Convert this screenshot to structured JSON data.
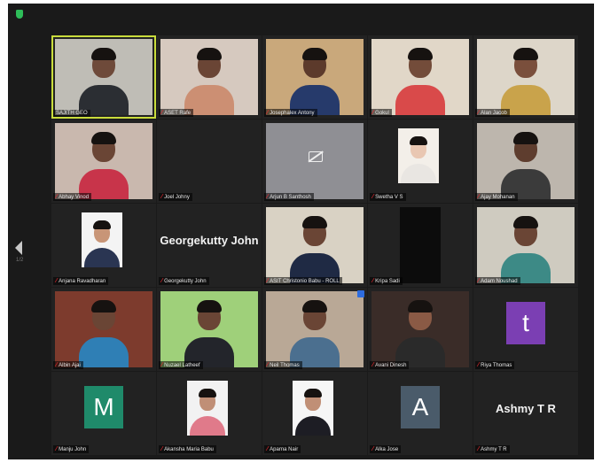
{
  "app": {
    "title": ""
  },
  "nav": {
    "page_indicator": "1/2"
  },
  "participants": [
    {
      "name": "SAJITH GEO",
      "kind": "video",
      "active": true,
      "bg": "#bfbdb6",
      "skin": "#6e4a3a",
      "shirt": "#2b2e33",
      "muted": false
    },
    {
      "name": "ASET Rafe",
      "kind": "video",
      "bg": "#d6c9bf",
      "skin": "#6a4535",
      "shirt": "#cc8f73",
      "muted": true
    },
    {
      "name": "Josephalex Antony",
      "kind": "video",
      "bg": "#c9a87b",
      "skin": "#5c3a2b",
      "shirt": "#263a6b",
      "muted": true
    },
    {
      "name": "Gokul",
      "kind": "video",
      "bg": "#e1d7c8",
      "skin": "#734c3a",
      "shirt": "#d94a4a",
      "muted": true
    },
    {
      "name": "Alan Jacob",
      "kind": "video",
      "bg": "#ddd6c9",
      "skin": "#7a4f3c",
      "shirt": "#c9a34b",
      "muted": true
    },
    {
      "name": "Abhay Vinod",
      "kind": "video",
      "bg": "#c9b8ae",
      "skin": "#6a4535",
      "shirt": "#c8344a",
      "muted": true
    },
    {
      "name": "Joel Johny",
      "kind": "blank",
      "bg": "#1c1c1c",
      "muted": true
    },
    {
      "name": "Arjun B Santhosh",
      "kind": "camoff",
      "bg": "#8f8f94",
      "muted": true
    },
    {
      "name": "Swetha V S",
      "kind": "portrait",
      "bg": "#f3efe9",
      "skin": "#e9c7b2",
      "shirt": "#e9e6e2",
      "muted": true
    },
    {
      "name": "Ajay Mohanan",
      "kind": "video",
      "bg": "#bdb6ad",
      "skin": "#5e3d2e",
      "shirt": "#3b3b3b",
      "muted": true
    },
    {
      "name": "Anjana Ravadharan",
      "kind": "portrait",
      "bg": "#f4f4f4",
      "skin": "#c89577",
      "shirt": "#2a3552",
      "muted": true
    },
    {
      "name": "Georgekutty John",
      "kind": "text",
      "bigname": "Georgekutty John",
      "bg": "#222",
      "muted": true
    },
    {
      "name": "ASIT Christonio Babu - ROLL",
      "kind": "video",
      "bg": "#d9d2c4",
      "skin": "#6a4535",
      "shirt": "#1f2a44",
      "muted": true
    },
    {
      "name": "Kripa Sadi",
      "kind": "dark",
      "bg": "#0c0c0c",
      "muted": true
    },
    {
      "name": "Adam Noushad",
      "kind": "video",
      "bg": "#cfcbc0",
      "skin": "#6a4535",
      "shirt": "#3d8a86",
      "muted": true
    },
    {
      "name": "Albin Ajai",
      "kind": "video",
      "bg": "#7d3b2d",
      "skin": "#6a4535",
      "shirt": "#2f7fb5",
      "muted": true
    },
    {
      "name": "Nuzael Latheef",
      "kind": "video",
      "bg": "#9fd07a",
      "skin": "#6a4535",
      "shirt": "#23252b",
      "muted": true
    },
    {
      "name": "Neil Thomas",
      "kind": "video",
      "bg": "#b9a896",
      "skin": "#6a4535",
      "shirt": "#4b6f8f",
      "muted": true
    },
    {
      "name": "Avani Dinesh",
      "kind": "video",
      "bg": "#3a2c28",
      "skin": "#8a5a45",
      "shirt": "#2a2a2a",
      "muted": true
    },
    {
      "name": "Riya Thomas",
      "kind": "letter",
      "letter": "t",
      "color": "#7b3fb3",
      "muted": true
    },
    {
      "name": "Manju John",
      "kind": "letter",
      "letter": "M",
      "color": "#1f8a6a",
      "muted": true
    },
    {
      "name": "Akansha Maria Babu",
      "kind": "portrait",
      "bg": "#f2f2f2",
      "skin": "#c08f76",
      "shirt": "#e07a8a",
      "muted": true
    },
    {
      "name": "Aparna Nair",
      "kind": "portrait",
      "bg": "#f6f6f6",
      "skin": "#c08f76",
      "shirt": "#1d1d24",
      "muted": true
    },
    {
      "name": "Alka Jose",
      "kind": "letter",
      "letter": "A",
      "color": "#4a5b6a",
      "muted": true
    },
    {
      "name": "Ashmy T R",
      "kind": "text",
      "bigname": "Ashmy T R",
      "bg": "#222",
      "muted": true
    }
  ]
}
